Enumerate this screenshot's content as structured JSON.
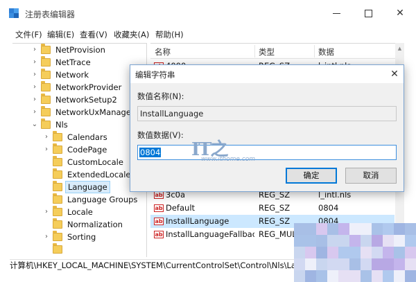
{
  "window": {
    "title": "注册表编辑器",
    "minimize": "—",
    "maximize": "□",
    "close": "✕"
  },
  "menu": [
    "文件(F)",
    "编辑(E)",
    "查看(V)",
    "收藏夹(A)",
    "帮助(H)"
  ],
  "tree": {
    "items": [
      {
        "label": "NetProvision",
        "expander": "›"
      },
      {
        "label": "NetTrace",
        "expander": "›"
      },
      {
        "label": "Network",
        "expander": "›"
      },
      {
        "label": "NetworkProvider",
        "expander": "›"
      },
      {
        "label": "NetworkSetup2",
        "expander": "›"
      },
      {
        "label": "NetworkUxManager",
        "expander": "›"
      },
      {
        "label": "Nls",
        "expander": "⌄"
      },
      {
        "label": "Calendars",
        "expander": "›"
      },
      {
        "label": "CodePage",
        "expander": "›"
      },
      {
        "label": "CustomLocale",
        "expander": ""
      },
      {
        "label": "ExtendedLocale",
        "expander": ""
      },
      {
        "label": "Language",
        "expander": ""
      },
      {
        "label": "Language Groups",
        "expander": ""
      },
      {
        "label": "Locale",
        "expander": "›"
      },
      {
        "label": "Normalization",
        "expander": ""
      },
      {
        "label": "Sorting",
        "expander": "›"
      }
    ]
  },
  "list": {
    "columns": [
      "名称",
      "类型",
      "数据"
    ],
    "rows_top": [
      {
        "name": "4000",
        "type": "REG_SZ",
        "data": "l_intl.nls"
      }
    ],
    "rows": [
      {
        "name": "3c0a",
        "type": "REG_SZ",
        "data": "l_intl.nls"
      },
      {
        "name": "Default",
        "type": "REG_SZ",
        "data": "0804"
      },
      {
        "name": "InstallLanguage",
        "type": "REG_SZ",
        "data": "0804"
      },
      {
        "name": "InstallLanguageFallback",
        "type": "REG_MULTI_SZ",
        "data": ""
      }
    ]
  },
  "status": "计算机\\HKEY_LOCAL_MACHINE\\SYSTEM\\CurrentControlSet\\Control\\Nls\\Language",
  "dialog": {
    "title": "编辑字符串",
    "close": "✕",
    "name_label": "数值名称(N):",
    "name_value": "InstallLanguage",
    "data_label": "数值数据(V):",
    "data_value": "0804",
    "ok": "确定",
    "cancel": "取消"
  },
  "watermark": {
    "logo": "IT之家",
    "url": "www.ithome.com"
  },
  "colors": {
    "selection": "#cce8ff",
    "accent": "#0078d7",
    "folder": "#f5cd5a"
  }
}
